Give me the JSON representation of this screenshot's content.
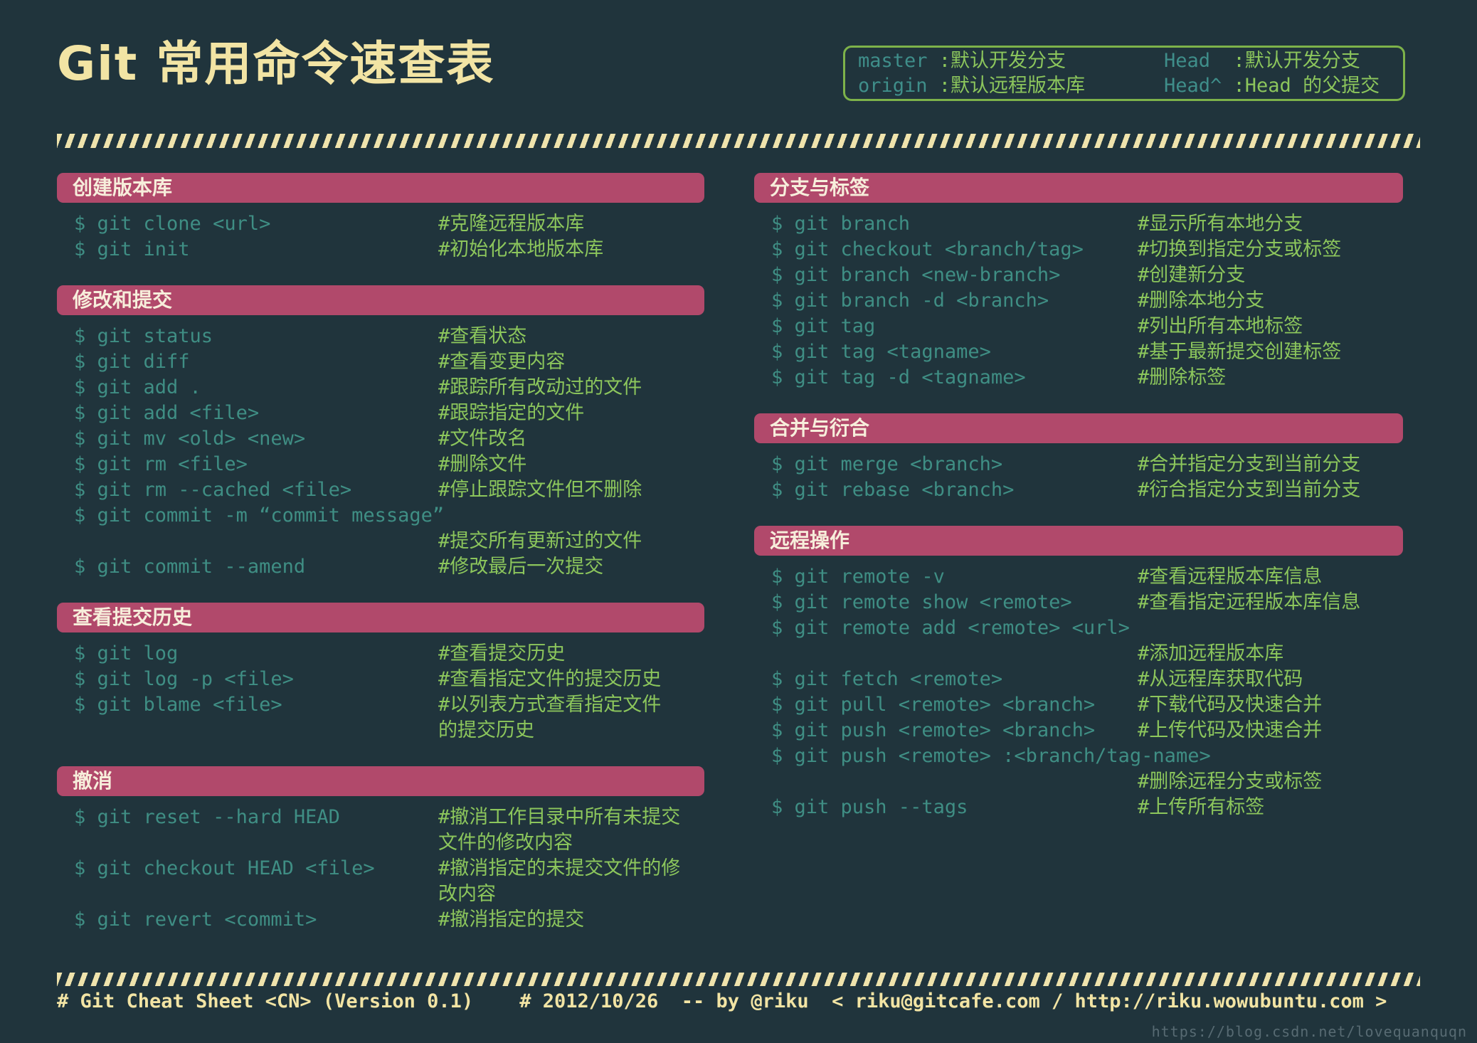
{
  "title": "Git 常用命令速查表",
  "colors": {
    "background": "#20343c",
    "section_header_bg": "#b1496b",
    "section_header_text": "#f7eedb",
    "command_text": "#3f8e84",
    "comment_text": "#8cc65c",
    "title_cream": "#f2e4a4",
    "legend_border": "#7db24a",
    "divider_stripe": "#efe3ac"
  },
  "legend": {
    "items": [
      {
        "term": "master",
        "def": ":默认开发分支"
      },
      {
        "term": "Head",
        "def": ":默认开发分支"
      },
      {
        "term": "origin",
        "def": ":默认远程版本库"
      },
      {
        "term": "Head^",
        "def": ":Head 的父提交"
      }
    ]
  },
  "left_sections": [
    {
      "title": "创建版本库",
      "lines": [
        {
          "cmd": "$ git clone <url>",
          "cmt": "#克隆远程版本库"
        },
        {
          "cmd": "$ git init",
          "cmt": "#初始化本地版本库"
        }
      ]
    },
    {
      "title": "修改和提交",
      "lines": [
        {
          "cmd": "$ git status",
          "cmt": "#查看状态"
        },
        {
          "cmd": "$ git diff",
          "cmt": "#查看变更内容"
        },
        {
          "cmd": "$ git add .",
          "cmt": "#跟踪所有改动过的文件"
        },
        {
          "cmd": "$ git add <file>",
          "cmt": "#跟踪指定的文件"
        },
        {
          "cmd": "$ git mv <old> <new>",
          "cmt": "#文件改名"
        },
        {
          "cmd": "$ git rm <file>",
          "cmt": "#删除文件"
        },
        {
          "cmd": "$ git rm --cached <file>",
          "cmt": "#停止跟踪文件但不删除"
        },
        {
          "cmd": "$ git commit -m “commit message”",
          "cmt": ""
        },
        {
          "cmd": "",
          "cmt": "#提交所有更新过的文件"
        },
        {
          "cmd": "$ git commit --amend",
          "cmt": "#修改最后一次提交"
        }
      ]
    },
    {
      "title": "查看提交历史",
      "lines": [
        {
          "cmd": "$ git log",
          "cmt": "#查看提交历史"
        },
        {
          "cmd": "$ git log -p <file>",
          "cmt": "#查看指定文件的提交历史"
        },
        {
          "cmd": "$ git blame <file>",
          "cmt": "#以列表方式查看指定文件\n的提交历史"
        }
      ]
    },
    {
      "title": "撤消",
      "lines": [
        {
          "cmd": "$ git reset --hard HEAD",
          "cmt": "#撤消工作目录中所有未提交\n文件的修改内容"
        },
        {
          "cmd": "$ git checkout HEAD <file>",
          "cmt": "#撤消指定的未提交文件的修\n改内容"
        },
        {
          "cmd": "$ git revert <commit>",
          "cmt": "#撤消指定的提交"
        }
      ]
    }
  ],
  "right_sections": [
    {
      "title": "分支与标签",
      "lines": [
        {
          "cmd": "$ git branch",
          "cmt": "#显示所有本地分支"
        },
        {
          "cmd": "$ git checkout <branch/tag>",
          "cmt": "#切换到指定分支或标签"
        },
        {
          "cmd": "$ git branch <new-branch>",
          "cmt": "#创建新分支"
        },
        {
          "cmd": "$ git branch -d <branch>",
          "cmt": "#删除本地分支"
        },
        {
          "cmd": "$ git tag",
          "cmt": "#列出所有本地标签"
        },
        {
          "cmd": "$ git tag <tagname>",
          "cmt": "#基于最新提交创建标签"
        },
        {
          "cmd": "$ git tag -d <tagname>",
          "cmt": "#删除标签"
        }
      ]
    },
    {
      "title": "合并与衍合",
      "lines": [
        {
          "cmd": "$ git merge <branch>",
          "cmt": "#合并指定分支到当前分支"
        },
        {
          "cmd": "$ git rebase <branch>",
          "cmt": "#衍合指定分支到当前分支"
        }
      ]
    },
    {
      "title": "远程操作",
      "lines": [
        {
          "cmd": "$ git remote -v",
          "cmt": "#查看远程版本库信息"
        },
        {
          "cmd": "$ git remote show <remote>",
          "cmt": "#查看指定远程版本库信息"
        },
        {
          "cmd": "$ git remote add <remote> <url>",
          "cmt": ""
        },
        {
          "cmd": "",
          "cmt": "#添加远程版本库"
        },
        {
          "cmd": "$ git fetch <remote>",
          "cmt": "#从远程库获取代码"
        },
        {
          "cmd": "$ git pull <remote> <branch>",
          "cmt": "#下载代码及快速合并"
        },
        {
          "cmd": "$ git push <remote> <branch>",
          "cmt": "#上传代码及快速合并"
        },
        {
          "cmd": "$ git push <remote> :<branch/tag-name>",
          "cmt": ""
        },
        {
          "cmd": "",
          "cmt": "#删除远程分支或标签"
        },
        {
          "cmd": "$ git push --tags",
          "cmt": "#上传所有标签"
        }
      ]
    }
  ],
  "footer": {
    "text": "# Git Cheat Sheet <CN> (Version 0.1)    # 2012/10/26  -- by @riku  < riku@gitcafe.com / http://riku.wowubuntu.com >"
  },
  "watermark": "https://blog.csdn.net/lovequanquqn"
}
